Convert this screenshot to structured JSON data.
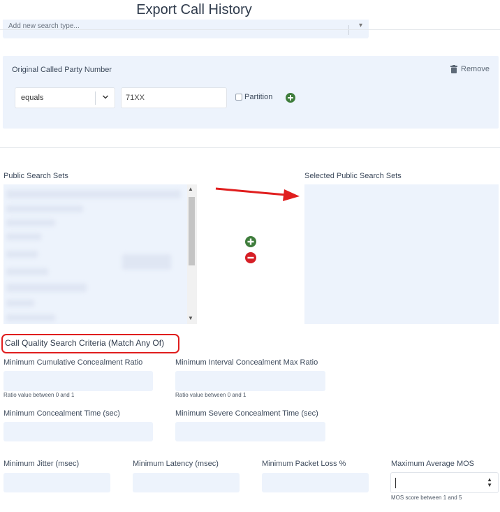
{
  "page": {
    "title": "Export Call History"
  },
  "search_type": {
    "placeholder": "Add new search type..."
  },
  "criterion": {
    "label": "Original Called Party Number",
    "remove_label": "Remove",
    "operator": "equals",
    "value": "71XX",
    "partition_label": "Partition"
  },
  "search_sets": {
    "public_label": "Public Search Sets",
    "selected_label": "Selected Public Search Sets"
  },
  "call_quality": {
    "title": "Call Quality Search Criteria (Match Any Of)",
    "min_cumulative_ratio": {
      "label": "Minimum Cumulative Concealment Ratio",
      "hint": "Ratio value between 0 and 1"
    },
    "min_interval_max_ratio": {
      "label": "Minimum Interval Concealment Max Ratio",
      "hint": "Ratio value between 0 and 1"
    },
    "min_concealment_time": {
      "label": "Minimum Concealment Time (sec)"
    },
    "min_severe_time": {
      "label": "Minimum Severe Concealment Time (sec)"
    },
    "min_jitter": {
      "label": "Minimum Jitter (msec)"
    },
    "min_latency": {
      "label": "Minimum Latency (msec)"
    },
    "min_packet_loss": {
      "label": "Minimum Packet Loss %"
    },
    "max_avg_mos": {
      "label": "Maximum Average MOS",
      "hint": "MOS score between 1 and 5"
    }
  },
  "colors": {
    "panel_bg": "#edf3fc",
    "add_green": "#3f7d3c",
    "remove_red": "#d61f26",
    "highlight_red": "#e01e1e"
  }
}
